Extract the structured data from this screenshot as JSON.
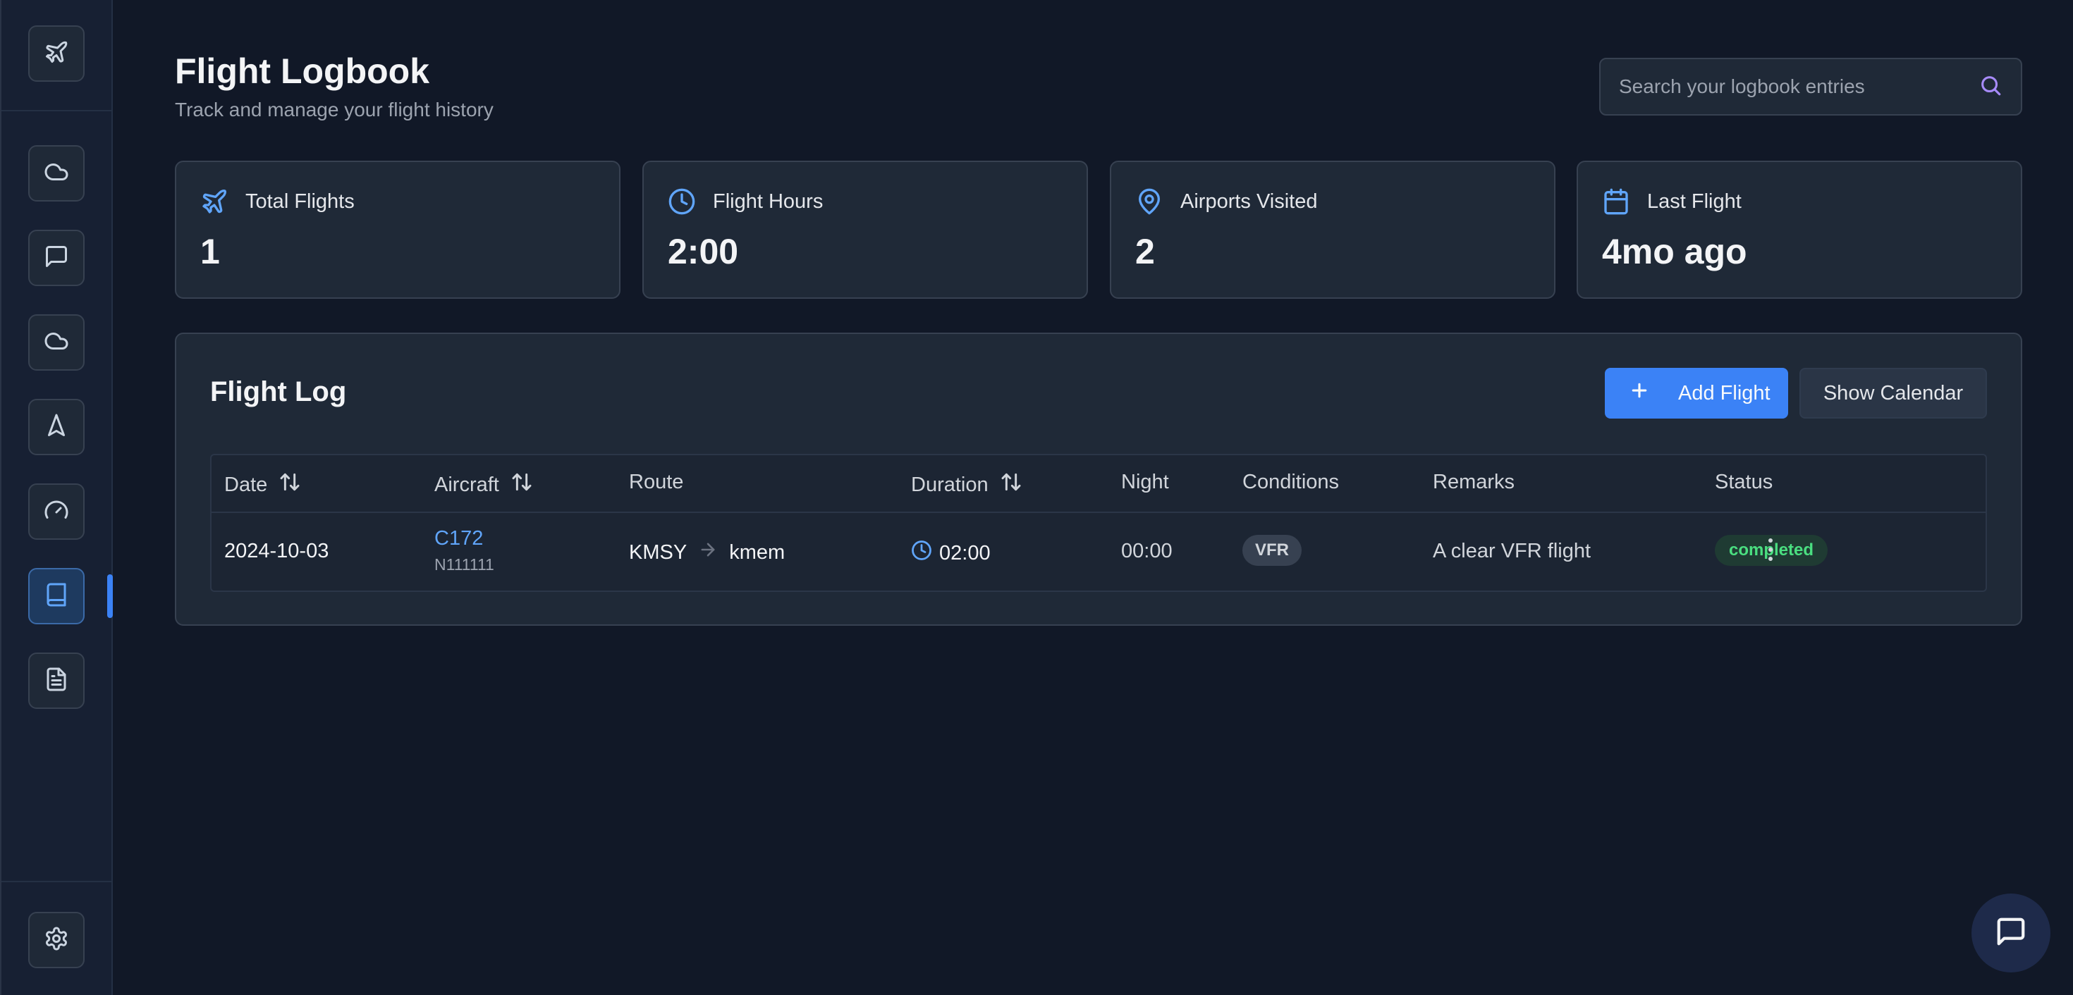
{
  "header": {
    "title": "Flight Logbook",
    "subtitle": "Track and manage your flight history",
    "search_placeholder": "Search your logbook entries"
  },
  "sidebar": {
    "logo_icon": "plane-icon",
    "items": [
      {
        "icon": "cloud-icon",
        "active": false
      },
      {
        "icon": "message-icon",
        "active": false
      },
      {
        "icon": "cloud-icon",
        "active": false
      },
      {
        "icon": "navigation-icon",
        "active": false
      },
      {
        "icon": "gauge-icon",
        "active": false
      },
      {
        "icon": "book-icon",
        "active": true
      },
      {
        "icon": "document-icon",
        "active": false
      }
    ],
    "settings_icon": "gear-icon"
  },
  "stats": [
    {
      "icon": "plane-icon",
      "label": "Total Flights",
      "value": "1"
    },
    {
      "icon": "clock-icon",
      "label": "Flight Hours",
      "value": "2:00"
    },
    {
      "icon": "map-pin-icon",
      "label": "Airports Visited",
      "value": "2"
    },
    {
      "icon": "calendar-icon",
      "label": "Last Flight",
      "value": "4mo ago"
    }
  ],
  "flight_log": {
    "title": "Flight Log",
    "add_button": "Add Flight",
    "calendar_button": "Show Calendar",
    "columns": [
      "Date",
      "Aircraft",
      "Route",
      "Duration",
      "Night",
      "Conditions",
      "Remarks",
      "Status"
    ],
    "rows": [
      {
        "date": "2024-10-03",
        "aircraft_type": "C172",
        "registration": "N111111",
        "from": "KMSY",
        "to": "kmem",
        "duration": "02:00",
        "night": "00:00",
        "conditions": "VFR",
        "remarks": "A clear VFR flight",
        "status": "completed"
      }
    ]
  },
  "colors": {
    "background": "#111827",
    "card": "#1f2937",
    "accent": "#3b82f6",
    "status_completed": "#4ade80"
  }
}
